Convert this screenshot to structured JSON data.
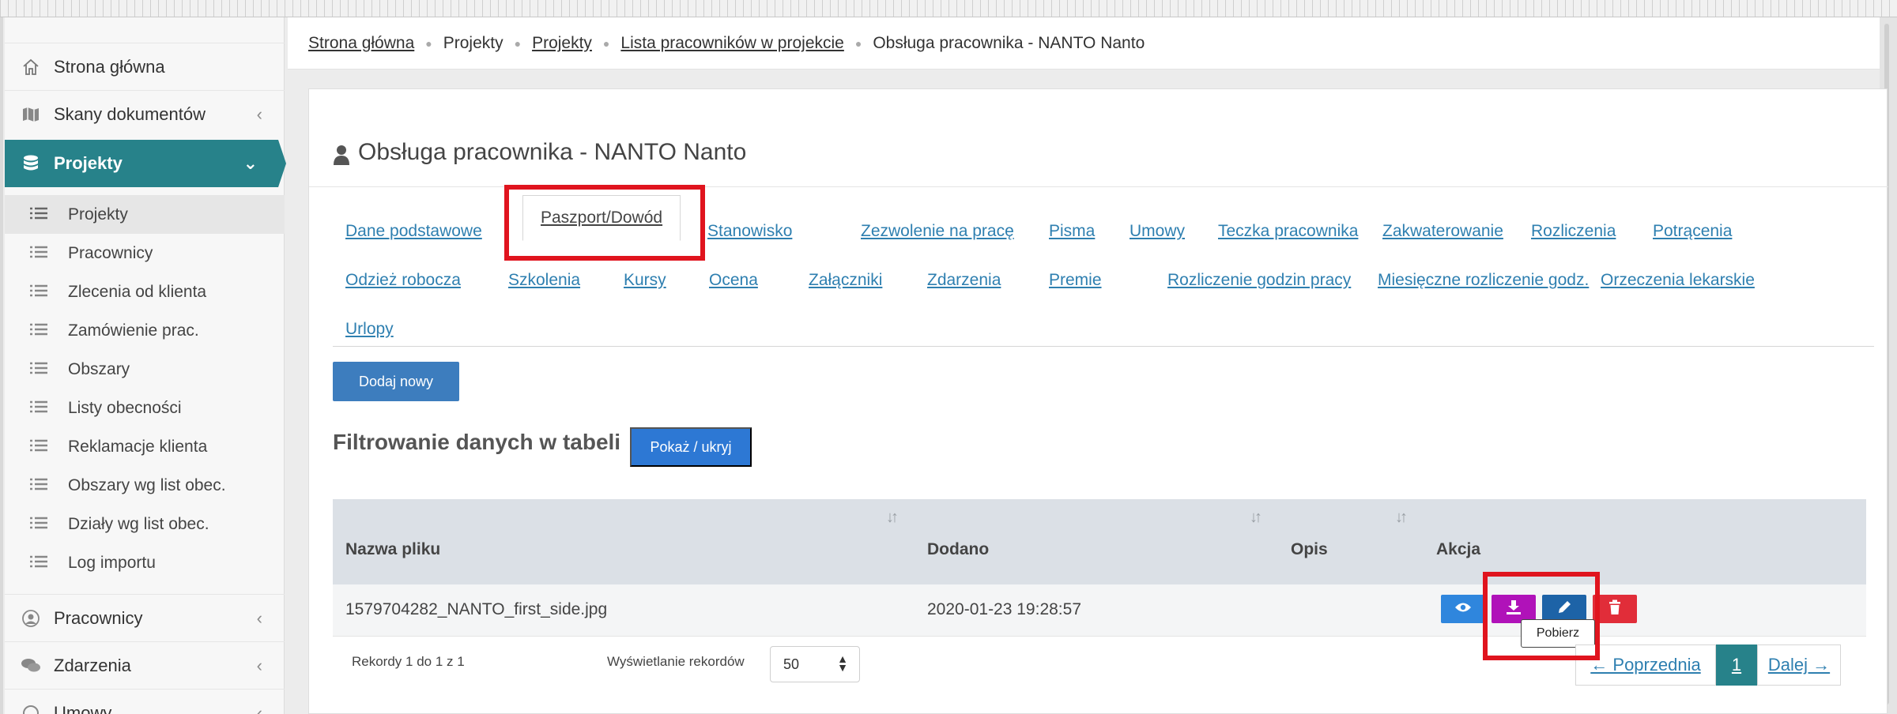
{
  "sidebar": {
    "items": [
      {
        "label": "Strona główna",
        "icon": "home-icon"
      },
      {
        "label": "Skany dokumentów",
        "icon": "map-icon"
      },
      {
        "label": "Projekty",
        "icon": "database-icon"
      },
      {
        "label": "Pracownicy",
        "icon": "user-circle-icon"
      },
      {
        "label": "Zdarzenia",
        "icon": "comments-icon"
      },
      {
        "label": "Umowy",
        "icon": "contract-icon"
      }
    ],
    "sub_items": [
      {
        "label": "Projekty"
      },
      {
        "label": "Pracownicy"
      },
      {
        "label": "Zlecenia od klienta"
      },
      {
        "label": "Zamówienie prac."
      },
      {
        "label": "Obszary"
      },
      {
        "label": "Listy obecności"
      },
      {
        "label": "Reklamacje klienta"
      },
      {
        "label": "Obszary wg list obec."
      },
      {
        "label": "Działy wg list obec."
      },
      {
        "label": "Log importu"
      }
    ]
  },
  "breadcrumb": {
    "items": [
      "Strona główna",
      "Projekty",
      "Projekty",
      "Lista pracowników w projekcie",
      "Obsługa pracownika - NANTO Nanto"
    ]
  },
  "page": {
    "title": "Obsługa pracownika - NANTO Nanto"
  },
  "tabs": {
    "row1": [
      "Dane podstawowe",
      "Paszport/Dowód",
      "Stanowisko",
      "Zezwolenie na pracę",
      "Pisma",
      "Umowy",
      "Teczka pracownika",
      "Zakwaterowanie",
      "Rozliczenia",
      "Potrącenia"
    ],
    "row2": [
      "Odzież robocza",
      "Szkolenia",
      "Kursy",
      "Ocena",
      "Załączniki",
      "Zdarzenia",
      "Premie",
      "Rozliczenie godzin pracy",
      "Miesięczne rozliczenie godz.",
      "Orzeczenia lekarskie"
    ],
    "row3": [
      "Urlopy"
    ],
    "active": "Paszport/Dowód"
  },
  "actions": {
    "add_label": "Dodaj nowy",
    "filter_title": "Filtrowanie danych w tabeli",
    "toggle_label": "Pokaż / ukryj"
  },
  "table": {
    "columns": [
      "Nazwa pliku",
      "Dodano",
      "Opis",
      "Akcja"
    ],
    "rows": [
      {
        "filename": "1579704282_NANTO_first_side.jpg",
        "added": "2020-01-23 19:28:57",
        "description": ""
      }
    ],
    "row_actions": [
      "view-icon",
      "download-icon",
      "edit-icon",
      "trash-icon"
    ],
    "tooltip": "Pobierz"
  },
  "footer": {
    "records": "Rekordy 1 do 1 z 1",
    "perpage_label": "Wyświetlanie rekordów",
    "perpage_value": "50",
    "prev": "← Poprzednia",
    "current_page": "1",
    "next": "Dalej →"
  },
  "colors": {
    "accent": "#27828a",
    "add_button": "#3d7dbe",
    "view_button": "#2f86dd",
    "download_button": "#b012b9",
    "edit_button": "#1d63a7",
    "delete_button": "#e12d39",
    "highlight": "#e0141e"
  }
}
